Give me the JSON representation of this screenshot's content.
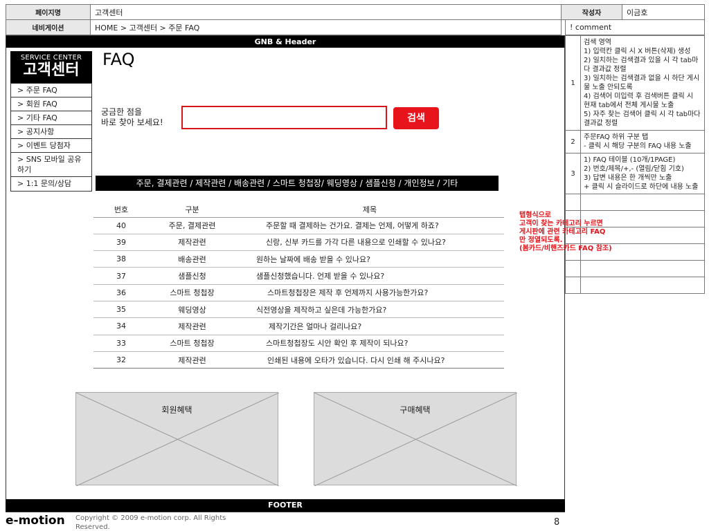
{
  "header": {
    "page_name_label": "페이지명",
    "page_name": "고객센터",
    "author_label": "작성자",
    "author": "이금호",
    "nav_label": "네비게이션",
    "nav_path": "HOME > 고객센터 > 주문 FAQ",
    "comment_label": "! comment"
  },
  "wire": {
    "gnb": "GNB & Header",
    "footer": "FOOTER",
    "service_center_en": "SERVICE CENTER",
    "service_center_ko": "고객센터",
    "faq_title": "FAQ",
    "question_line1": "궁금한 점을",
    "question_line2": "바로 찾아 보세요!",
    "search_button": "검색",
    "tabs": "주문, 결제관련 / 제작관련 / 배송관련 / 스마트 청첩장/ 웨딩영상 / 샘플신청 / 개인정보 / 기타",
    "banner_left": "회원혜택",
    "banner_right": "구매혜택",
    "logo": "e-motion",
    "copyright": "Copyright © 2009 e-motion corp. All Rights Reserved.",
    "page_number": "8"
  },
  "side_menu": [
    "> 주문 FAQ",
    "> 회원 FAQ",
    "> 기타 FAQ",
    "> 공지사항",
    "> 이벤트 당첨자",
    "> SNS 모바일 공유하기",
    "> 1:1 문의/상담"
  ],
  "faq_table": {
    "headers": [
      "번호",
      "구분",
      "제목"
    ],
    "rows": [
      [
        "40",
        "주문, 결제관련",
        "주문할 때 결제하는 건가요. 결제는 언제, 어떻게 하죠?"
      ],
      [
        "39",
        "제작관련",
        "신랑, 신부 카드를 가각 다른 내용으로 인쇄할 수 있나요?"
      ],
      [
        "38",
        "배송관련",
        "원하는 날짜에 배송 받을 수 있나요?"
      ],
      [
        "37",
        "샘플신청",
        "샘플신청했습니다. 언제 받을 수 있나요?"
      ],
      [
        "36",
        "스마트 청첩장",
        "스마트청첩장은 제작 후 언제까지 사용가능한가요?"
      ],
      [
        "35",
        "웨딩영상",
        "식전영상을 제작하고 싶은데 가능한가요?"
      ],
      [
        "34",
        "제작관련",
        "제작기간은 얼마나 걸리나요?"
      ],
      [
        "33",
        "스마트 청첩장",
        "스마트청첩장도 시안 확인 후 제작이 되나요?"
      ],
      [
        "32",
        "제작관련",
        "인쇄된 내용에 오타가 있습니다. 다시 인쇄 해 주시나요?"
      ]
    ]
  },
  "comments": [
    {
      "num": "1",
      "lines": [
        "검색 영역",
        "1) 입력칸 클릭 시 X 버튼(삭제) 생성",
        "2) 일치하는 검색결과 있을 시 각 tab마다 결과값 정렬",
        "3) 일치하는 검색결과 없을 시 하단 게시물 노출 안되도록",
        "4) 검색어 미입력 후 검색버튼 클릭 시 현재 tab에서 전체 게시물 노출",
        "5) 자주 찾는 검색어 클릭 시 각 tab마다 결과값 정렬"
      ]
    },
    {
      "num": "2",
      "lines": [
        "주문FAQ 하위 구분 탭",
        "- 클릭 시 해당 구분의 FAQ 내용 노출"
      ]
    },
    {
      "num": "3",
      "lines": [
        "1) FAQ 테이블 (10개/1PAGE)",
        "2) 번호/제목/+,- (열림/닫힘 기호)",
        "3) 답변 내용은 한 개씩만 노출",
        "+ 클릭 시 슬라이드로 하단에 내용 노출"
      ]
    }
  ],
  "red_note": [
    "탭형식으로",
    "고객이 찾는 카테고리 누르면",
    "게시판에 관련 카테고리 FAQ",
    "만 정열되도록.",
    "(봄카드/비핸즈카드 FAQ 참조)"
  ]
}
